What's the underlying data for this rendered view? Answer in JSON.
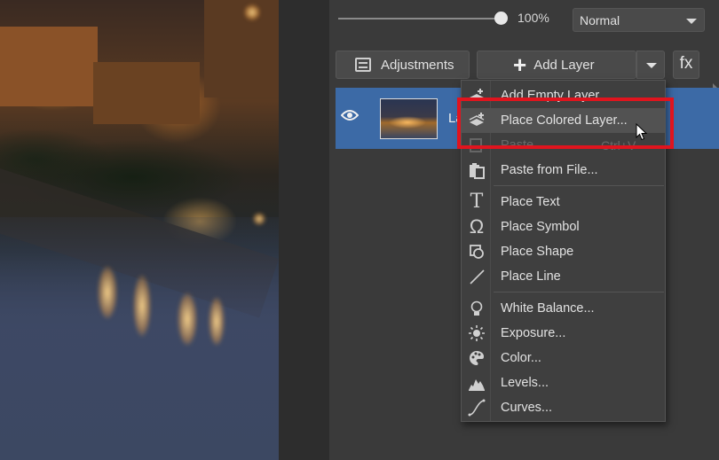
{
  "layers_panel": {
    "opacity_value": "100%",
    "blend_mode": "Normal",
    "adjustments_label": "Adjustments",
    "add_layer_label": "Add Layer",
    "fx_label": "fx",
    "layer_name": "La"
  },
  "add_layer_menu": {
    "items": [
      {
        "label": "Add Empty Layer",
        "icon": "layer-plus-icon"
      },
      {
        "label": "Place Colored Layer...",
        "icon": "colored-layer-icon",
        "highlighted": true
      },
      {
        "label": "Paste",
        "shortcut": "Ctrl+V",
        "icon": "paste-icon",
        "disabled": true
      },
      {
        "label": "Paste from File...",
        "icon": "paste-file-icon"
      },
      {
        "label": "Place Text",
        "icon": "text-icon"
      },
      {
        "label": "Place Symbol",
        "icon": "omega-icon"
      },
      {
        "label": "Place Shape",
        "icon": "shape-icon"
      },
      {
        "label": "Place Line",
        "icon": "line-icon"
      },
      {
        "label": "White Balance...",
        "icon": "lightbulb-icon"
      },
      {
        "label": "Exposure...",
        "icon": "sun-icon"
      },
      {
        "label": "Color...",
        "icon": "palette-icon"
      },
      {
        "label": "Levels...",
        "icon": "histogram-icon"
      },
      {
        "label": "Curves...",
        "icon": "curve-icon"
      }
    ]
  },
  "colors": {
    "accent_selection": "#3c6aa6",
    "highlight_box": "#e0141e",
    "panel_bg": "#3a3a3a"
  }
}
